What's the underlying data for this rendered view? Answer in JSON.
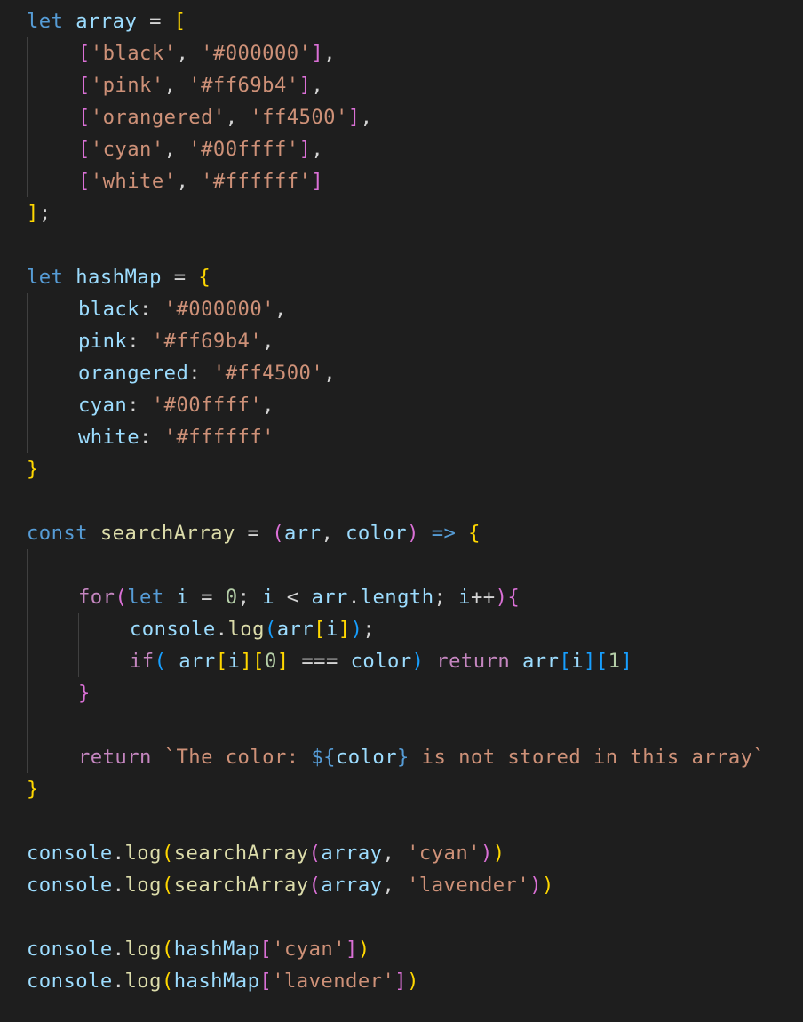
{
  "editor": {
    "language": "javascript",
    "theme": "dark",
    "colors": {
      "background": "#1e1e1e",
      "keyword": "#569cd6",
      "control": "#c586c0",
      "variable": "#9cdcfe",
      "function": "#dcdcaa",
      "string": "#ce9178",
      "number": "#b5cea8",
      "bracket_level_1": "#ffd700",
      "bracket_level_2": "#da70d6",
      "bracket_level_3": "#179fff",
      "indent_guide": "#404040"
    },
    "lines": [
      {
        "indent": 0,
        "tokens": [
          [
            "kw",
            "let"
          ],
          [
            "punc",
            " "
          ],
          [
            "var",
            "array"
          ],
          [
            "punc",
            " = "
          ],
          [
            "p1",
            "["
          ]
        ]
      },
      {
        "indent": 1,
        "tokens": [
          [
            "p2",
            "["
          ],
          [
            "str",
            "'black'"
          ],
          [
            "punc",
            ", "
          ],
          [
            "str",
            "'#000000'"
          ],
          [
            "p2",
            "]"
          ],
          [
            "punc",
            ","
          ]
        ]
      },
      {
        "indent": 1,
        "tokens": [
          [
            "p2",
            "["
          ],
          [
            "str",
            "'pink'"
          ],
          [
            "punc",
            ", "
          ],
          [
            "str",
            "'#ff69b4'"
          ],
          [
            "p2",
            "]"
          ],
          [
            "punc",
            ","
          ]
        ]
      },
      {
        "indent": 1,
        "tokens": [
          [
            "p2",
            "["
          ],
          [
            "str",
            "'orangered'"
          ],
          [
            "punc",
            ", "
          ],
          [
            "str",
            "'ff4500'"
          ],
          [
            "p2",
            "]"
          ],
          [
            "punc",
            ","
          ]
        ]
      },
      {
        "indent": 1,
        "tokens": [
          [
            "p2",
            "["
          ],
          [
            "str",
            "'cyan'"
          ],
          [
            "punc",
            ", "
          ],
          [
            "str",
            "'#00ffff'"
          ],
          [
            "p2",
            "]"
          ],
          [
            "punc",
            ","
          ]
        ]
      },
      {
        "indent": 1,
        "tokens": [
          [
            "p2",
            "["
          ],
          [
            "str",
            "'white'"
          ],
          [
            "punc",
            ", "
          ],
          [
            "str",
            "'#ffffff'"
          ],
          [
            "p2",
            "]"
          ]
        ]
      },
      {
        "indent": 0,
        "tokens": [
          [
            "p1",
            "]"
          ],
          [
            "punc",
            ";"
          ]
        ]
      },
      {
        "indent": 0,
        "tokens": []
      },
      {
        "indent": 0,
        "tokens": [
          [
            "kw",
            "let"
          ],
          [
            "punc",
            " "
          ],
          [
            "var",
            "hashMap"
          ],
          [
            "punc",
            " = "
          ],
          [
            "p1",
            "{"
          ]
        ]
      },
      {
        "indent": 1,
        "tokens": [
          [
            "var",
            "black"
          ],
          [
            "punc",
            ": "
          ],
          [
            "str",
            "'#000000'"
          ],
          [
            "punc",
            ","
          ]
        ]
      },
      {
        "indent": 1,
        "tokens": [
          [
            "var",
            "pink"
          ],
          [
            "punc",
            ": "
          ],
          [
            "str",
            "'#ff69b4'"
          ],
          [
            "punc",
            ","
          ]
        ]
      },
      {
        "indent": 1,
        "tokens": [
          [
            "var",
            "orangered"
          ],
          [
            "punc",
            ": "
          ],
          [
            "str",
            "'#ff4500'"
          ],
          [
            "punc",
            ","
          ]
        ]
      },
      {
        "indent": 1,
        "tokens": [
          [
            "var",
            "cyan"
          ],
          [
            "punc",
            ": "
          ],
          [
            "str",
            "'#00ffff'"
          ],
          [
            "punc",
            ","
          ]
        ]
      },
      {
        "indent": 1,
        "tokens": [
          [
            "var",
            "white"
          ],
          [
            "punc",
            ": "
          ],
          [
            "str",
            "'#ffffff'"
          ]
        ]
      },
      {
        "indent": 0,
        "tokens": [
          [
            "p1",
            "}"
          ]
        ]
      },
      {
        "indent": 0,
        "tokens": []
      },
      {
        "indent": 0,
        "tokens": [
          [
            "kw",
            "const"
          ],
          [
            "punc",
            " "
          ],
          [
            "fn",
            "searchArray"
          ],
          [
            "punc",
            " = "
          ],
          [
            "p2",
            "("
          ],
          [
            "var",
            "arr"
          ],
          [
            "punc",
            ", "
          ],
          [
            "var",
            "color"
          ],
          [
            "p2",
            ")"
          ],
          [
            "punc",
            " "
          ],
          [
            "kw",
            "=>"
          ],
          [
            "punc",
            " "
          ],
          [
            "p1",
            "{"
          ]
        ]
      },
      {
        "indent": 1,
        "tokens": []
      },
      {
        "indent": 1,
        "tokens": [
          [
            "ctl",
            "for"
          ],
          [
            "p2",
            "("
          ],
          [
            "kw",
            "let"
          ],
          [
            "punc",
            " "
          ],
          [
            "var",
            "i"
          ],
          [
            "punc",
            " = "
          ],
          [
            "num",
            "0"
          ],
          [
            "punc",
            "; "
          ],
          [
            "var",
            "i"
          ],
          [
            "punc",
            " < "
          ],
          [
            "var",
            "arr"
          ],
          [
            "punc",
            "."
          ],
          [
            "var",
            "length"
          ],
          [
            "punc",
            "; "
          ],
          [
            "var",
            "i"
          ],
          [
            "punc",
            "++"
          ],
          [
            "p2",
            ")"
          ],
          [
            "p2",
            "{"
          ]
        ]
      },
      {
        "indent": 2,
        "tokens": [
          [
            "var",
            "console"
          ],
          [
            "punc",
            "."
          ],
          [
            "fn",
            "log"
          ],
          [
            "p3",
            "("
          ],
          [
            "var",
            "arr"
          ],
          [
            "p1",
            "["
          ],
          [
            "var",
            "i"
          ],
          [
            "p1",
            "]"
          ],
          [
            "p3",
            ")"
          ],
          [
            "punc",
            ";"
          ]
        ]
      },
      {
        "indent": 2,
        "tokens": [
          [
            "ctl",
            "if"
          ],
          [
            "p3",
            "("
          ],
          [
            "punc",
            " "
          ],
          [
            "var",
            "arr"
          ],
          [
            "p1",
            "["
          ],
          [
            "var",
            "i"
          ],
          [
            "p1",
            "]"
          ],
          [
            "p1",
            "["
          ],
          [
            "num",
            "0"
          ],
          [
            "p1",
            "]"
          ],
          [
            "punc",
            " === "
          ],
          [
            "var",
            "color"
          ],
          [
            "p3",
            ")"
          ],
          [
            "punc",
            " "
          ],
          [
            "ctl",
            "return"
          ],
          [
            "punc",
            " "
          ],
          [
            "var",
            "arr"
          ],
          [
            "p3",
            "["
          ],
          [
            "var",
            "i"
          ],
          [
            "p3",
            "]"
          ],
          [
            "p3",
            "["
          ],
          [
            "num",
            "1"
          ],
          [
            "p3",
            "]"
          ]
        ]
      },
      {
        "indent": 1,
        "tokens": [
          [
            "p2",
            "}"
          ]
        ]
      },
      {
        "indent": 1,
        "tokens": []
      },
      {
        "indent": 1,
        "tokens": [
          [
            "ctl",
            "return"
          ],
          [
            "punc",
            " "
          ],
          [
            "str",
            "`The color: "
          ],
          [
            "kw",
            "${"
          ],
          [
            "var",
            "color"
          ],
          [
            "kw",
            "}"
          ],
          [
            "str",
            " is not stored in this array`"
          ]
        ]
      },
      {
        "indent": 0,
        "tokens": [
          [
            "p1",
            "}"
          ]
        ]
      },
      {
        "indent": 0,
        "tokens": []
      },
      {
        "indent": 0,
        "tokens": [
          [
            "var",
            "console"
          ],
          [
            "punc",
            "."
          ],
          [
            "fn",
            "log"
          ],
          [
            "p1",
            "("
          ],
          [
            "fn",
            "searchArray"
          ],
          [
            "p2",
            "("
          ],
          [
            "var",
            "array"
          ],
          [
            "punc",
            ", "
          ],
          [
            "str",
            "'cyan'"
          ],
          [
            "p2",
            ")"
          ],
          [
            "p1",
            ")"
          ]
        ]
      },
      {
        "indent": 0,
        "tokens": [
          [
            "var",
            "console"
          ],
          [
            "punc",
            "."
          ],
          [
            "fn",
            "log"
          ],
          [
            "p1",
            "("
          ],
          [
            "fn",
            "searchArray"
          ],
          [
            "p2",
            "("
          ],
          [
            "var",
            "array"
          ],
          [
            "punc",
            ", "
          ],
          [
            "str",
            "'lavender'"
          ],
          [
            "p2",
            ")"
          ],
          [
            "p1",
            ")"
          ]
        ]
      },
      {
        "indent": 0,
        "tokens": []
      },
      {
        "indent": 0,
        "tokens": [
          [
            "var",
            "console"
          ],
          [
            "punc",
            "."
          ],
          [
            "fn",
            "log"
          ],
          [
            "p1",
            "("
          ],
          [
            "var",
            "hashMap"
          ],
          [
            "p2",
            "["
          ],
          [
            "str",
            "'cyan'"
          ],
          [
            "p2",
            "]"
          ],
          [
            "p1",
            ")"
          ]
        ]
      },
      {
        "indent": 0,
        "tokens": [
          [
            "var",
            "console"
          ],
          [
            "punc",
            "."
          ],
          [
            "fn",
            "log"
          ],
          [
            "p1",
            "("
          ],
          [
            "var",
            "hashMap"
          ],
          [
            "p2",
            "["
          ],
          [
            "str",
            "'lavender'"
          ],
          [
            "p2",
            "]"
          ],
          [
            "p1",
            ")"
          ]
        ]
      }
    ]
  }
}
